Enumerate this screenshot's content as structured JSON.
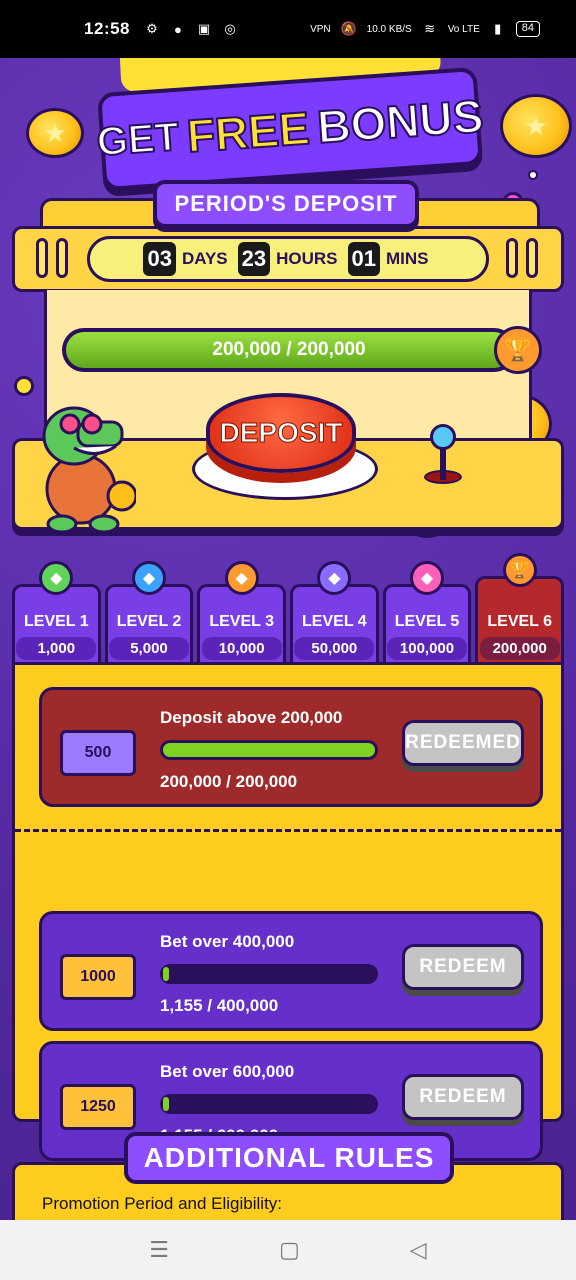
{
  "status_bar": {
    "time": "12:58",
    "net_speed": "10.0 KB/S",
    "vpn_label": "VPN",
    "lte_label": "Vo LTE",
    "battery": "84"
  },
  "header": {
    "word_get": "GET",
    "word_free": "FREE",
    "word_bonus": "BONUS"
  },
  "period": {
    "title": "PERIOD'S DEPOSIT",
    "days": "03",
    "days_label": "DAYS",
    "hours": "23",
    "hours_label": "HOURS",
    "mins": "01",
    "mins_label": "MINS"
  },
  "deposit_progress": {
    "text": "200,000 / 200,000",
    "fraction": 1.0
  },
  "deposit_button": {
    "label": "DEPOSIT"
  },
  "levels": [
    {
      "name": "LEVEL 1",
      "amount": "1,000",
      "gem_color": "#5fd35a",
      "active": false
    },
    {
      "name": "LEVEL 2",
      "amount": "5,000",
      "gem_color": "#3aa3ff",
      "active": false
    },
    {
      "name": "LEVEL 3",
      "amount": "10,000",
      "gem_color": "#ff9a2e",
      "active": false
    },
    {
      "name": "LEVEL 4",
      "amount": "50,000",
      "gem_color": "#8a6bff",
      "active": false
    },
    {
      "name": "LEVEL 5",
      "amount": "100,000",
      "gem_color": "#ff5fb8",
      "active": false
    },
    {
      "name": "LEVEL 6",
      "amount": "200,000",
      "gem_color": "#ff9a2e",
      "active": true
    }
  ],
  "tasks": [
    {
      "ticket": "500",
      "ticket_color": "#9d7bff",
      "title": "Deposit above 200,000",
      "progress_text": "200,000 / 200,000",
      "progress": 1.0,
      "button": "REDEEMED",
      "state": "redeemed"
    },
    {
      "ticket": "1000",
      "ticket_color": "#ffc13a",
      "title": "Bet over 400,000",
      "progress_text": "1,155 / 400,000",
      "progress": 0.003,
      "button": "REDEEM",
      "state": "open"
    },
    {
      "ticket": "1250",
      "ticket_color": "#ffc13a",
      "title": "Bet over 600,000",
      "progress_text": "1,155 / 600,000",
      "progress": 0.002,
      "button": "REDEEM",
      "state": "open"
    }
  ],
  "rules": {
    "title": "ADDITIONAL RULES",
    "first_heading": "Promotion Period and Eligibility:"
  },
  "colors": {
    "background": "#5b2fa8",
    "accent_yellow": "#ffcc1f",
    "outline": "#2a0f5c",
    "progress_green": "#7ed321"
  }
}
